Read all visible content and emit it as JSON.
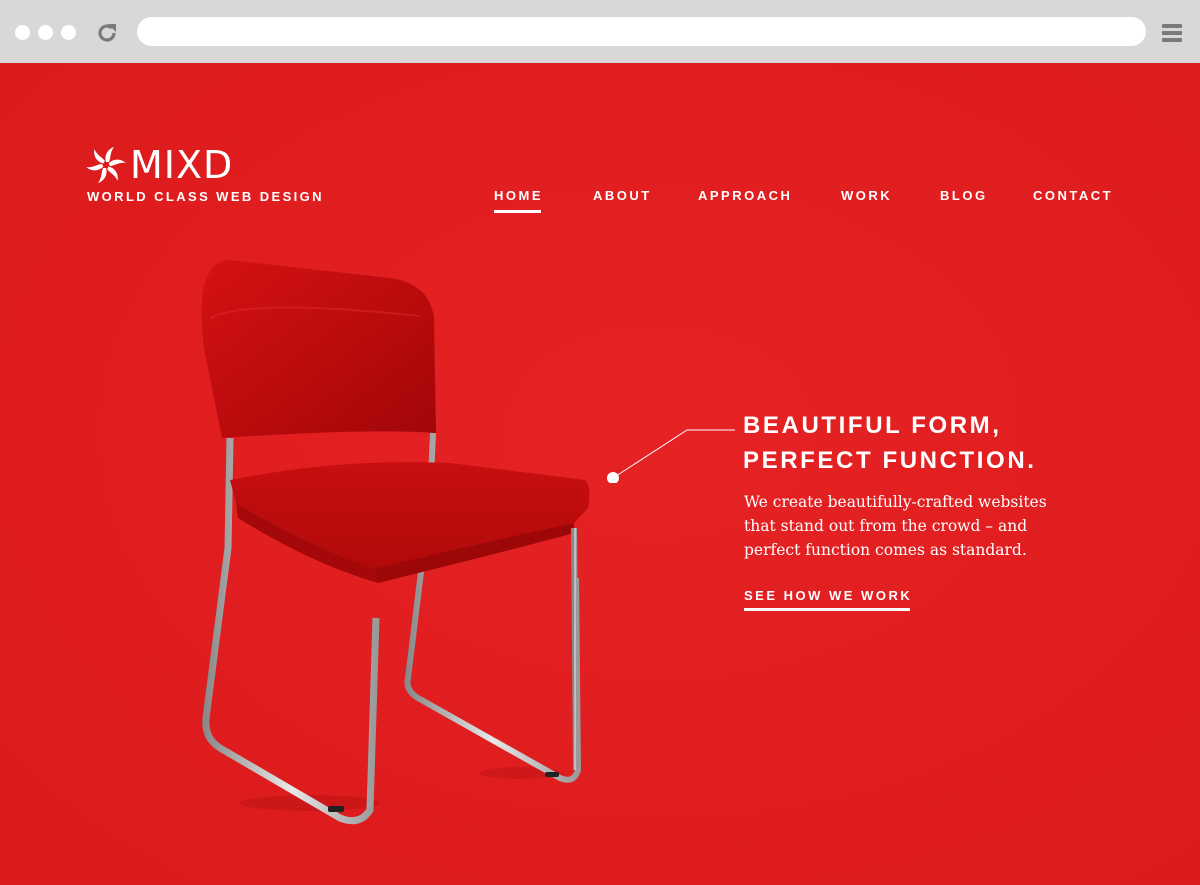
{
  "browser": {
    "window_controls": [
      "close-dot",
      "minimize-dot",
      "zoom-dot"
    ],
    "reload_icon": "reload-icon",
    "url": "",
    "menu_icon": "hamburger-menu-icon"
  },
  "site": {
    "logo_text": "MIXD",
    "tagline": "WORLD CLASS WEB DESIGN",
    "logo_icon": "pinwheel-logo-icon"
  },
  "nav": {
    "items": [
      {
        "label": "HOME",
        "active": true
      },
      {
        "label": "ABOUT",
        "active": false
      },
      {
        "label": "APPROACH",
        "active": false
      },
      {
        "label": "WORK",
        "active": false
      },
      {
        "label": "BLOG",
        "active": false
      },
      {
        "label": "CONTACT",
        "active": false
      }
    ]
  },
  "hero": {
    "headline_line1": "BEAUTIFUL FORM,",
    "headline_line2": "PERFECT FUNCTION.",
    "body": "We create beautifully-crafted websites that stand out from the crowd – and perfect function comes as standard.",
    "cta": "SEE HOW WE WORK",
    "image": "red-chair-image"
  },
  "colors": {
    "background": "#e21d1f",
    "chrome": "#d8d8d8",
    "text": "#ffffff"
  }
}
